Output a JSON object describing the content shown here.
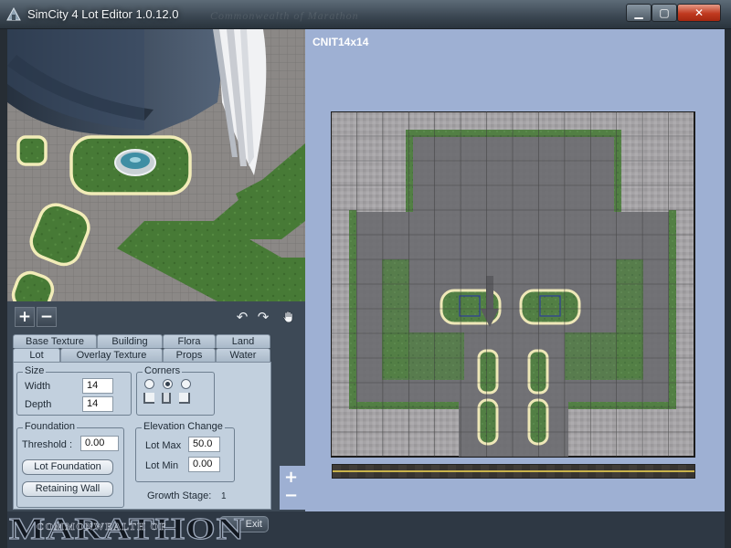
{
  "window": {
    "title": "SimCity 4 Lot Editor 1.0.12.0",
    "ghost_title": "Commonwealth of Marathon",
    "controls": {
      "minimize": "▁",
      "maximize": "▢",
      "close": "✕"
    }
  },
  "viewport": {
    "toolbar": {
      "zoom_in": "+",
      "zoom_out": "−"
    }
  },
  "tabs": {
    "back_row": [
      "Base Texture",
      "Building",
      "Flora",
      "Land"
    ],
    "front_row": [
      "Lot",
      "Overlay Texture",
      "Props",
      "Water"
    ],
    "active": "Lot"
  },
  "lot_tab": {
    "size": {
      "title": "Size",
      "width_label": "Width",
      "width_value": "14",
      "depth_label": "Depth",
      "depth_value": "14"
    },
    "corners": {
      "title": "Corners",
      "selected_index": 1
    },
    "foundation": {
      "title": "Foundation",
      "threshold_label": "Threshold :",
      "threshold_value": "0.00",
      "lot_foundation_button": "Lot Foundation",
      "retaining_wall_button": "Retaining Wall"
    },
    "elevation": {
      "title": "Elevation Change",
      "lot_max_label": "Lot Max",
      "lot_max_value": "50.0",
      "lot_min_label": "Lot Min",
      "lot_min_value": "0.00"
    },
    "growth_stage": {
      "label": "Growth Stage:",
      "value": "1"
    }
  },
  "lot_view": {
    "lot_name": "CNIT14x14",
    "zoom_in": "+",
    "zoom_out": "−",
    "grid_cells": 14
  },
  "footer": {
    "exit_button": "Exit"
  },
  "watermark": {
    "main": "MARATHON",
    "sub": "COMMONWEALTH OF"
  },
  "colors": {
    "title_gradient_top": "#5d6b77",
    "panel_bg": "#3d4956",
    "tab_bg": "#c2d0de",
    "lot_view_bg": "#9eb0d3",
    "close_button": "#c0391f",
    "paver": "#9c9a9d",
    "grass": "#4c7d3d",
    "building_footprint": "#6e6d72"
  }
}
